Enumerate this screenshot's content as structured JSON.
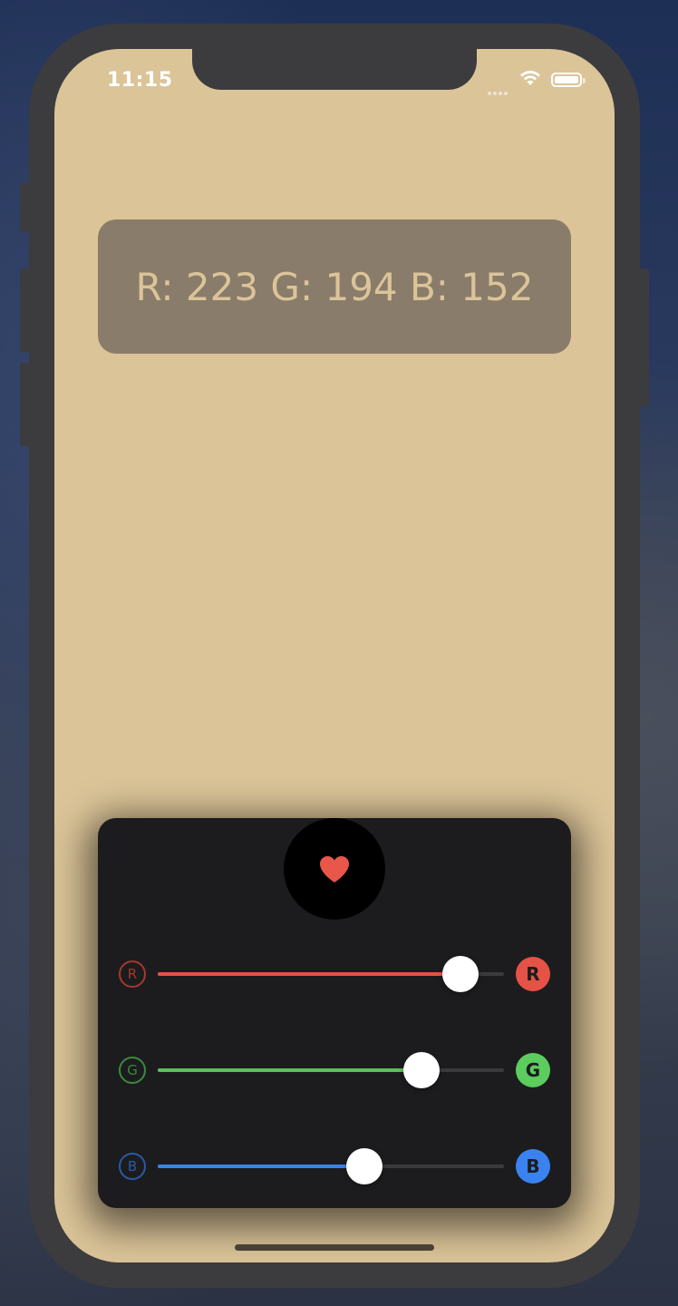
{
  "status_bar": {
    "time": "11:15"
  },
  "rgb_display": {
    "text": "R: 223 G: 194 B: 152",
    "background_color": "#dbc498"
  },
  "panel": {
    "favorite_button": {
      "icon": "heart-icon",
      "color": "#e9574a"
    },
    "sliders": [
      {
        "name": "red",
        "min_label": "R",
        "max_label": "R",
        "value": 223,
        "max": 255,
        "color": "#e55346"
      },
      {
        "name": "green",
        "min_label": "G",
        "max_label": "G",
        "value": 194,
        "max": 255,
        "color": "#5ccc5e"
      },
      {
        "name": "blue",
        "min_label": "B",
        "max_label": "B",
        "value": 152,
        "max": 255,
        "color": "#3a82f0"
      }
    ]
  }
}
